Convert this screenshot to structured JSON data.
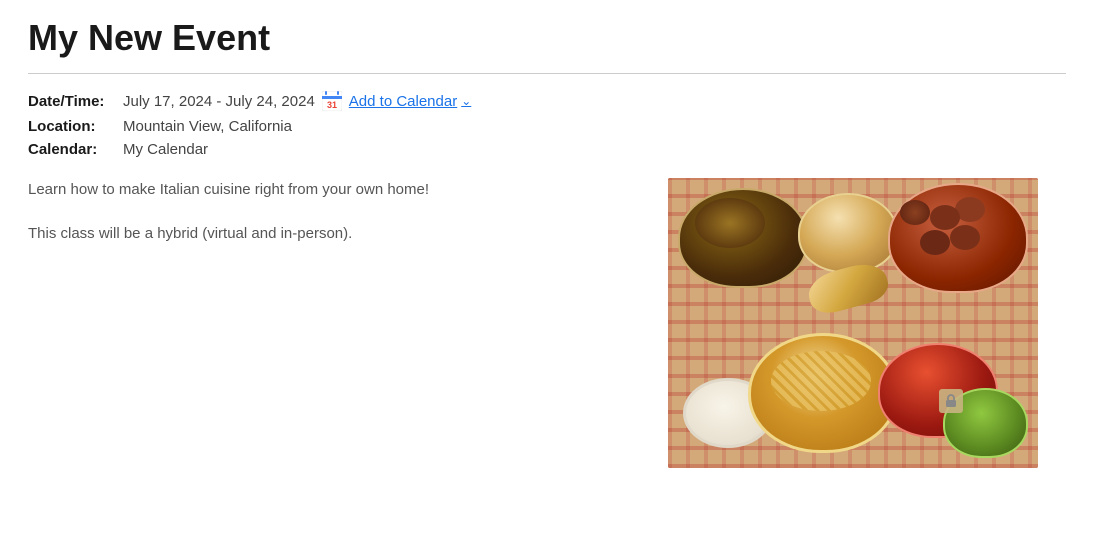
{
  "event": {
    "title": "My New Event",
    "datetime": {
      "label": "Date/Time:",
      "value": "July 17, 2024 - July 24, 2024"
    },
    "location": {
      "label": "Location:",
      "value": "Mountain View, California"
    },
    "calendar": {
      "label": "Calendar:",
      "value": "My Calendar"
    },
    "add_to_calendar": "Add to Calendar",
    "descriptions": [
      "Learn how to make Italian cuisine right from your own home!",
      "This class will be a hybrid (virtual and in-person)."
    ]
  }
}
